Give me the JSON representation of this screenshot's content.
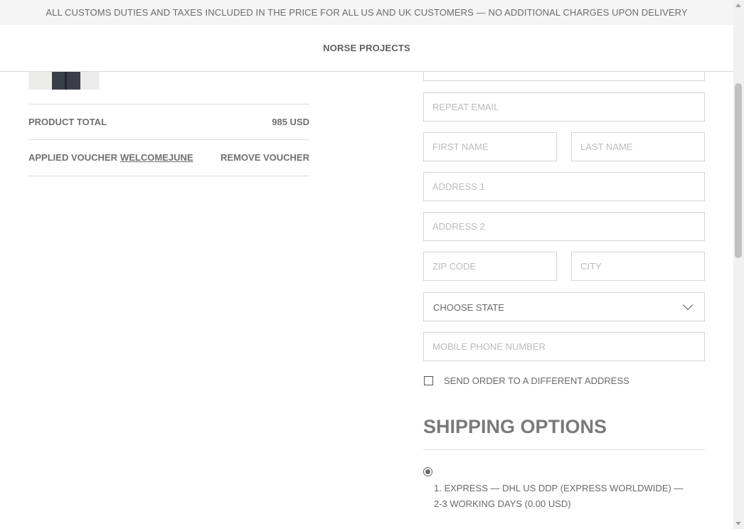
{
  "announcement": "ALL CUSTOMS DUTIES AND TAXES INCLUDED IN THE PRICE FOR ALL US AND UK CUSTOMERS — NO ADDITIONAL CHARGES UPON DELIVERY",
  "header": {
    "brand": "NORSE PROJECTS"
  },
  "summary": {
    "product_total_label": "PRODUCT TOTAL",
    "product_total_value": "985 USD",
    "voucher_label": "APPLIED VOUCHER",
    "voucher_code": "WELCOMEJUNE",
    "remove_voucher": "REMOVE VOUCHER"
  },
  "form": {
    "email": {
      "value": "",
      "placeholder": ""
    },
    "repeat_email": {
      "value": "",
      "placeholder": "REPEAT EMAIL"
    },
    "first_name": {
      "value": "",
      "placeholder": "FIRST NAME"
    },
    "last_name": {
      "value": "",
      "placeholder": "LAST NAME"
    },
    "address1": {
      "value": "",
      "placeholder": "ADDRESS 1"
    },
    "address2": {
      "value": "",
      "placeholder": "ADDRESS 2"
    },
    "zip": {
      "value": "",
      "placeholder": "ZIP CODE"
    },
    "city": {
      "value": "",
      "placeholder": "CITY"
    },
    "state": {
      "selected": "CHOOSE STATE"
    },
    "phone": {
      "value": "",
      "placeholder": "MOBILE PHONE NUMBER"
    },
    "different_address_label": "SEND ORDER TO A DIFFERENT ADDRESS",
    "different_address_checked": false
  },
  "shipping": {
    "title": "SHIPPING OPTIONS",
    "options": [
      {
        "label": "1. EXPRESS — DHL US DDP (EXPRESS WORLDWIDE) — 2-3 WORKING DAYS (0.00 USD)",
        "selected": true
      }
    ]
  },
  "icons": {
    "select_chevron": "chevron-down-icon"
  }
}
